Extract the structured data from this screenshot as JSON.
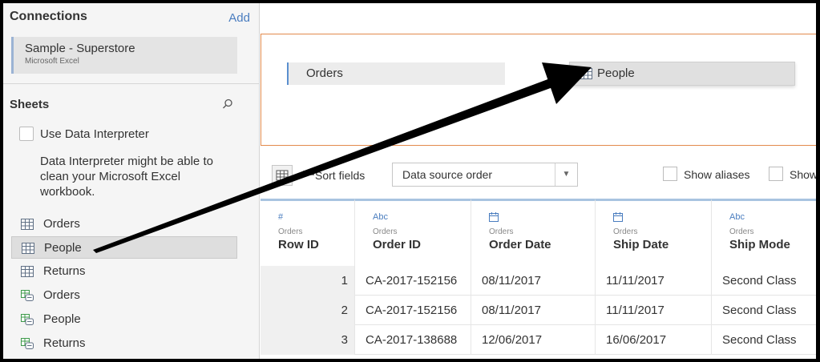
{
  "connections": {
    "title": "Connections",
    "add_label": "Add",
    "source_name": "Sample - Superstore",
    "source_type": "Microsoft Excel"
  },
  "sheets": {
    "title": "Sheets",
    "interpreter_label": "Use Data Interpreter",
    "interpreter_help": "Data Interpreter might be able to clean your Microsoft Excel workbook.",
    "items": [
      {
        "label": "Orders",
        "icon": "table-icon",
        "selected": false
      },
      {
        "label": "People",
        "icon": "table-icon",
        "selected": true
      },
      {
        "label": "Returns",
        "icon": "table-icon",
        "selected": false
      },
      {
        "label": "Orders",
        "icon": "named-range-icon",
        "selected": false
      },
      {
        "label": "People",
        "icon": "named-range-icon",
        "selected": false
      },
      {
        "label": "Returns",
        "icon": "named-range-icon",
        "selected": false
      }
    ]
  },
  "canvas": {
    "table1": "Orders",
    "dragged_table": "People"
  },
  "toolbar": {
    "sort_label": "Sort fields",
    "sort_value": "Data source order",
    "show_aliases": "Show aliases",
    "show_hidden": "Show"
  },
  "grid": {
    "columns": [
      {
        "type_icon": "#",
        "source": "Orders",
        "name": "Row ID"
      },
      {
        "type_icon": "Abc",
        "source": "Orders",
        "name": "Order ID"
      },
      {
        "type_icon": "calendar",
        "source": "Orders",
        "name": "Order Date"
      },
      {
        "type_icon": "calendar",
        "source": "Orders",
        "name": "Ship Date"
      },
      {
        "type_icon": "Abc",
        "source": "Orders",
        "name": "Ship Mode"
      }
    ],
    "rows": [
      [
        "1",
        "CA-2017-152156",
        "08/11/2017",
        "11/11/2017",
        "Second Class"
      ],
      [
        "2",
        "CA-2017-152156",
        "08/11/2017",
        "11/11/2017",
        "Second Class"
      ],
      [
        "3",
        "CA-2017-138688",
        "12/06/2017",
        "16/06/2017",
        "Second Class"
      ]
    ]
  },
  "colors": {
    "accent_blue": "#4a7dbf",
    "canvas_border": "#e28a4c",
    "header_top": "#a8c4e0"
  }
}
